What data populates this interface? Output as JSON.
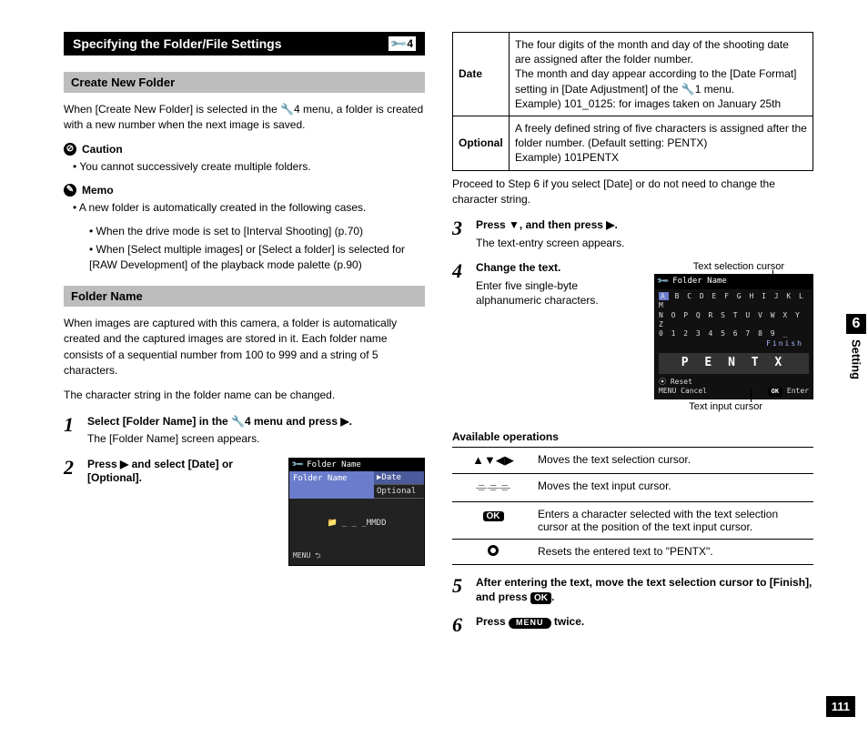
{
  "chapter": {
    "number": "6",
    "name": "Setting"
  },
  "page_number": "111",
  "section": {
    "title": "Specifying the Folder/File Settings",
    "menu_ref": "4"
  },
  "left": {
    "sub1": "Create New Folder",
    "p1": "When [Create New Folder] is selected in the 🔧4 menu, a folder is created with a new number when the next image is saved.",
    "caution_head": "Caution",
    "caution_items": [
      "You cannot successively create multiple folders."
    ],
    "memo_head": "Memo",
    "memo_intro": "A new folder is automatically created in the following cases.",
    "memo_sub": [
      "When the drive mode is set to [Interval Shooting] (p.70)",
      "When [Select multiple images] or [Select a folder] is selected for [RAW Development] of the playback mode palette (p.90)"
    ],
    "sub2": "Folder Name",
    "p2": "When images are captured with this camera, a folder is automatically created and the captured images are stored in it. Each folder name consists of a sequential number from 100 to 999 and a string of 5 characters.",
    "p3": "The character string in the folder name can be changed.",
    "step1": {
      "first": "Select [Folder Name] in the 🔧4 menu and press ▶.",
      "sub": "The [Folder Name] screen appears."
    },
    "step2": {
      "first": "Press ▶ and select [Date] or [Optional]."
    },
    "lcd1": {
      "title": "Folder Name",
      "field": "Folder Name",
      "opt1": "Date",
      "opt2": "Optional",
      "mid": "_ _ _MMDD",
      "exit": "MENU"
    }
  },
  "right": {
    "table": {
      "r1h": "Date",
      "r1b": "The four digits of the month and day of the shooting date are assigned after the folder number.\nThe month and day appear according to the [Date Format] setting in [Date Adjustment] of the 🔧1 menu.\nExample) 101_0125: for images taken on January 25th",
      "r2h": "Optional",
      "r2b": "A freely defined string of five characters is assigned after the folder number. (Default setting: PENTX)\nExample) 101PENTX"
    },
    "after_table": "Proceed to Step 6 if you select [Date] or do not need to change the character string.",
    "step3": {
      "first": "Press ▼, and then press ▶.",
      "sub": "The text-entry screen appears."
    },
    "step4": {
      "first": "Change the text.",
      "sub": "Enter five single-byte alphanumeric characters."
    },
    "fig_top_label": "Text selection cursor",
    "fig_bot_label": "Text input cursor",
    "lcd2": {
      "title": "Folder Name",
      "row1": "A B C D E F G H I J K L M",
      "row2": "N O P Q R S T U V W X Y Z",
      "row3_nums": "0 1 2 3 4 5 6 7 8 9 _",
      "finish": "Finish",
      "disp": "P E N T X",
      "reset": "Reset",
      "cancel": "Cancel",
      "enter": "Enter",
      "ok": "OK"
    },
    "ops_head": "Available operations",
    "ops": [
      {
        "k": "▲▼◀▶",
        "v": "Moves the text selection cursor."
      },
      {
        "k": "dial",
        "v": "Moves the text input cursor."
      },
      {
        "k": "OK",
        "v": "Enters a character selected with the text selection cursor at the position of the text input cursor."
      },
      {
        "k": "donut",
        "v": "Resets the entered text to \"PENTX\"."
      }
    ],
    "step5": {
      "first": "After entering the text, move the text selection cursor to [Finish], and press ",
      "first2": "."
    },
    "step6": {
      "first": "Press ",
      "first2": " twice."
    },
    "labels": {
      "ok": "OK",
      "menu": "MENU"
    }
  }
}
